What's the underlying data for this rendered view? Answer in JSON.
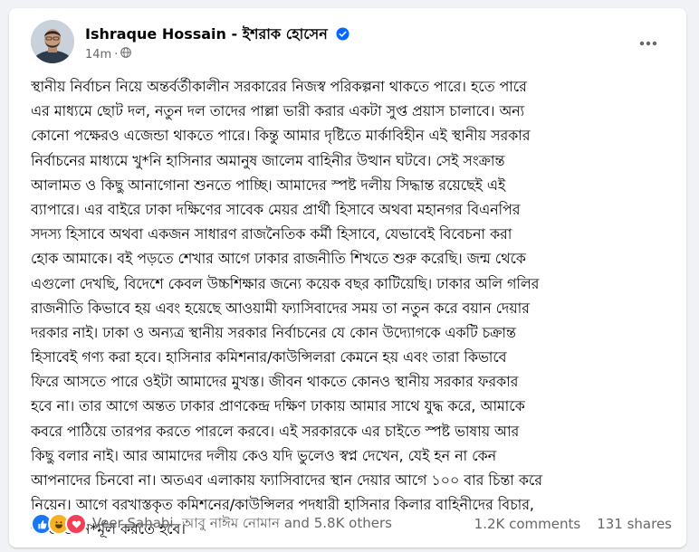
{
  "post": {
    "author_name": "Ishraque Hossain - ইশরাক হোসেন",
    "timestamp": "14m",
    "separator": "·",
    "audience_icon": "globe-icon",
    "more_icon": "more-options-icon",
    "body_lines": [
      "স্থানীয় নির্বাচন নিয়ে অন্তর্বর্তীকালীন সরকারের নিজস্ব পরিকল্পনা থাকতে পারে। হতে পারে",
      "এর মাধ্যমে ছোট দল, নতুন দল তাদের পাল্লা ভারী করার একটা সুপ্ত প্রয়াস চালাবে। অন্য",
      "কোনো পক্ষেরও এজেন্ডা থাকতে পারে। কিন্তু আমার দৃষ্টিতে মার্কাবিহীন এই স্থানীয় সরকার",
      "নির্বাচনের মাধ্যমে খু*নি হাসিনার অমানুষ জালেম বাহিনীর উত্থান ঘটবে। সেই সংক্রান্ত",
      "আলামত ও কিছু আনাগোনা শুনতে পাচ্ছি। আমাদের স্পষ্ট দলীয় সিদ্ধান্ত রয়েছেই এই",
      "ব্যাপারে। এর বাইরে ঢাকা দক্ষিণের সাবেক মেয়র প্রার্থী হিসাবে অথবা মহানগর বিএনপির",
      "সদস্য হিসাবে অথবা একজন সাধারণ রাজনৈতিক কর্মী হিসাবে, যেভাবেই বিবেচনা করা",
      "হোক আমাকে। বই পড়তে শেখার আগে ঢাকার রাজনীতি শিখতে শুরু করেছি। জন্ম থেকে",
      "এগুলো দেখছি, বিদেশে কেবল উচ্চশিক্ষার জন্যে কয়েক বছর কাটিয়েছি। ঢাকার অলি গলির",
      "রাজনীতি কিভাবে হয় এবং হয়েছে আওয়ামী ফ্যাসিবাদের সময় তা নতুন করে বয়ান দেয়ার",
      "দরকার নাই। ঢাকা ও অন্যত্র স্থানীয় সরকার নির্বাচনের যে কোন উদ্যোগকে একটি চক্রান্ত",
      "হিসাবেই গণ্য করা হবে। হাসিনার কমিশনার/কাউন্সিলরা কেমনে হয় এবং তারা কিভাবে",
      "ফিরে আসতে পারে ওইটা আমাদের মুখস্ত। জীবন থাকতে কোনও স্থানীয় সরকার ফরকার",
      "হবে না। তার আগে অন্তত ঢাকার প্রাণকেন্দ্র দক্ষিণ ঢাকায় আমার সাথে যুদ্ধ করে, আমাকে",
      "কবরে পাঠিয়ে তারপর করতে পারলে করবে। এই সরকারকে এর চাইতে স্পষ্ট ভাষায় আর",
      "কিছু বলার নাই।  আর আমাদের দলীয় কেও যদি ভুলেও স্বপ্ন দেখেন, যেই হন না কেন",
      "আপনাদের চিনবো না। অতএব এলাকায় ফ্যাসিবাদের স্থান দেয়ার আগে ১০০ বার চিন্তা করে",
      "নিয়েন। আগে বরখাস্তকৃত কমিশনের/কাউন্সিলর পদধারী হাসিনার কিলার বাহিনীদের বিচার,",
      "শাস্তি ও নি*র্মূল করতে হবে।"
    ]
  },
  "footer": {
    "reaction_icons": [
      "like-reaction-icon",
      "haha-reaction-icon",
      "love-reaction-icon"
    ],
    "reaction_names": "Veer Sahabi, আবু নাঈম নোমান and 5.8K others",
    "comments": "1.2K comments",
    "shares": "131 shares"
  },
  "colors": {
    "like_blue": "#1877f2",
    "haha_yellow": "#f7b125",
    "love_red": "#f33e58",
    "verified_blue": "#0866ff",
    "secondary_text": "#65676b"
  }
}
